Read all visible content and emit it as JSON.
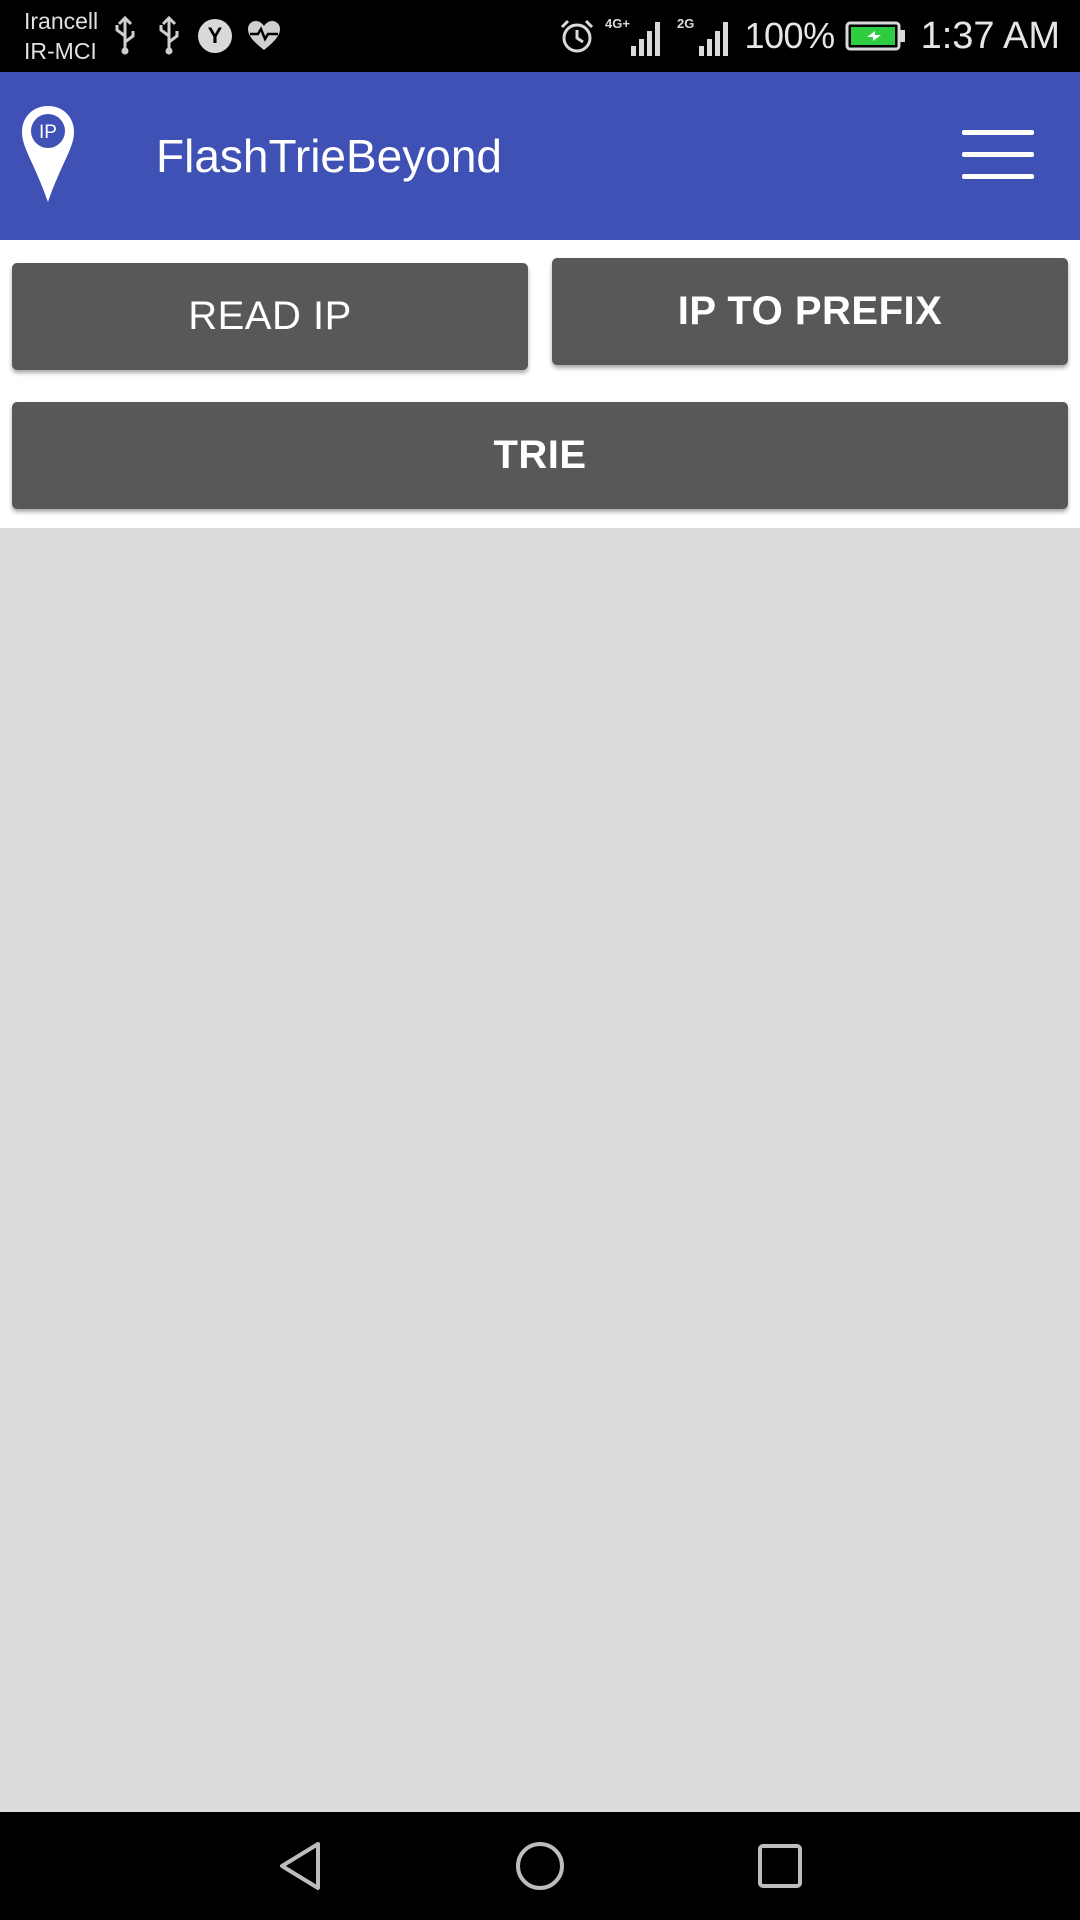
{
  "status_bar": {
    "carrier_line1": "Irancell",
    "carrier_line2": "IR-MCI",
    "badge_letter": "Y",
    "network_4g": "4G+",
    "network_2g": "2G",
    "battery_percent": "100%",
    "time": "1:37 AM",
    "icons": [
      "usb-icon",
      "usb-icon",
      "y-badge-icon",
      "heart-monitor-icon",
      "alarm-icon",
      "signal-icon",
      "signal-icon",
      "battery-charging-icon"
    ]
  },
  "app_bar": {
    "logo_text": "IP",
    "title": "FlashTrieBeyond",
    "menu_icon": "hamburger-menu-icon",
    "color": "#3f51b5"
  },
  "buttons": {
    "read_ip": "READ IP",
    "ip_to_prefix": "IP TO PREFIX",
    "trie": "TRIE",
    "color": "#58585a"
  },
  "nav_bar": {
    "icons": [
      "back-icon",
      "home-icon",
      "recent-apps-icon"
    ]
  },
  "colors": {
    "content_background": "#dcdcdc",
    "battery_fill": "#2ecc40"
  }
}
